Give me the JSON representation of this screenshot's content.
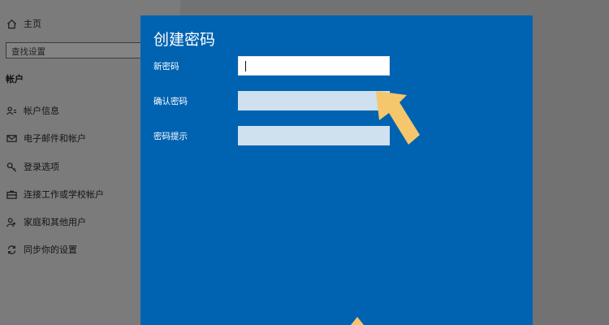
{
  "sidebar": {
    "home_label": "主页",
    "search_placeholder": "查找设置",
    "section_title": "帐户",
    "items": [
      {
        "label": "帐户信息",
        "icon": "account-info-icon"
      },
      {
        "label": "电子邮件和帐户",
        "icon": "mail-icon"
      },
      {
        "label": "登录选项",
        "icon": "key-icon"
      },
      {
        "label": "连接工作或学校帐户",
        "icon": "briefcase-icon"
      },
      {
        "label": "家庭和其他用户",
        "icon": "person-add-icon"
      },
      {
        "label": "同步你的设置",
        "icon": "sync-icon"
      }
    ]
  },
  "dialog": {
    "title": "创建密码",
    "fields": [
      {
        "label": "新密码",
        "value": ""
      },
      {
        "label": "确认密码",
        "value": ""
      },
      {
        "label": "密码提示",
        "value": ""
      }
    ]
  },
  "colors": {
    "dialog_bg": "#0063b1",
    "annotation_arrow": "#f5c66c"
  }
}
